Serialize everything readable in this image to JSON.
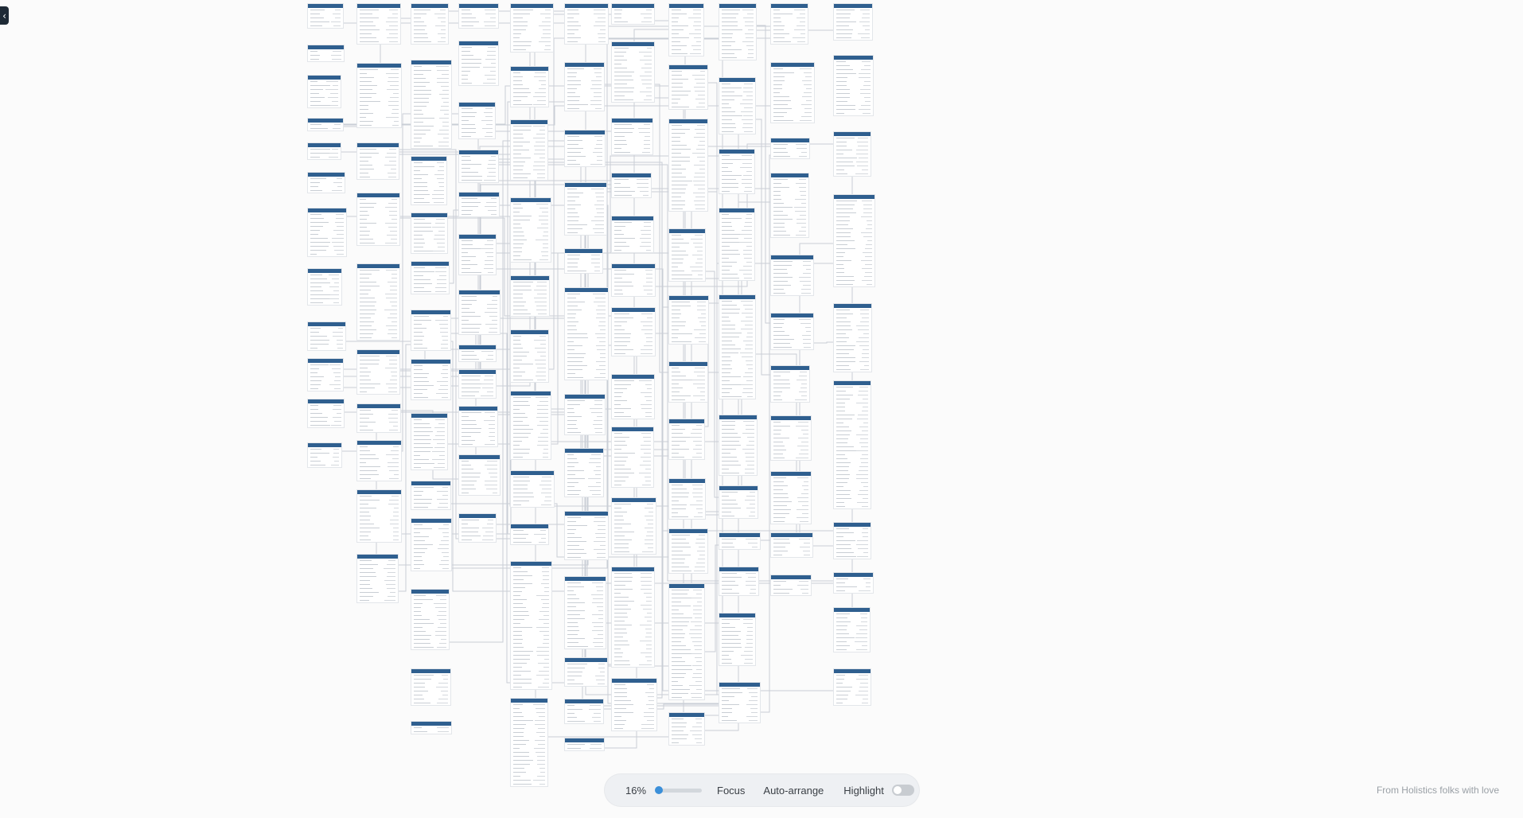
{
  "toolbar": {
    "zoom_label": "16%",
    "zoom_fraction": 0.16,
    "focus_label": "Focus",
    "auto_arrange_label": "Auto-arrange",
    "highlight_label": "Highlight",
    "highlight_on": false
  },
  "credit": "From Holistics folks with love",
  "colors": {
    "table_header": "#2f5f8f",
    "accent": "#3b8fd9",
    "background": "#fbfbfb"
  },
  "icons": {
    "collapse": "chevron-left-icon"
  }
}
